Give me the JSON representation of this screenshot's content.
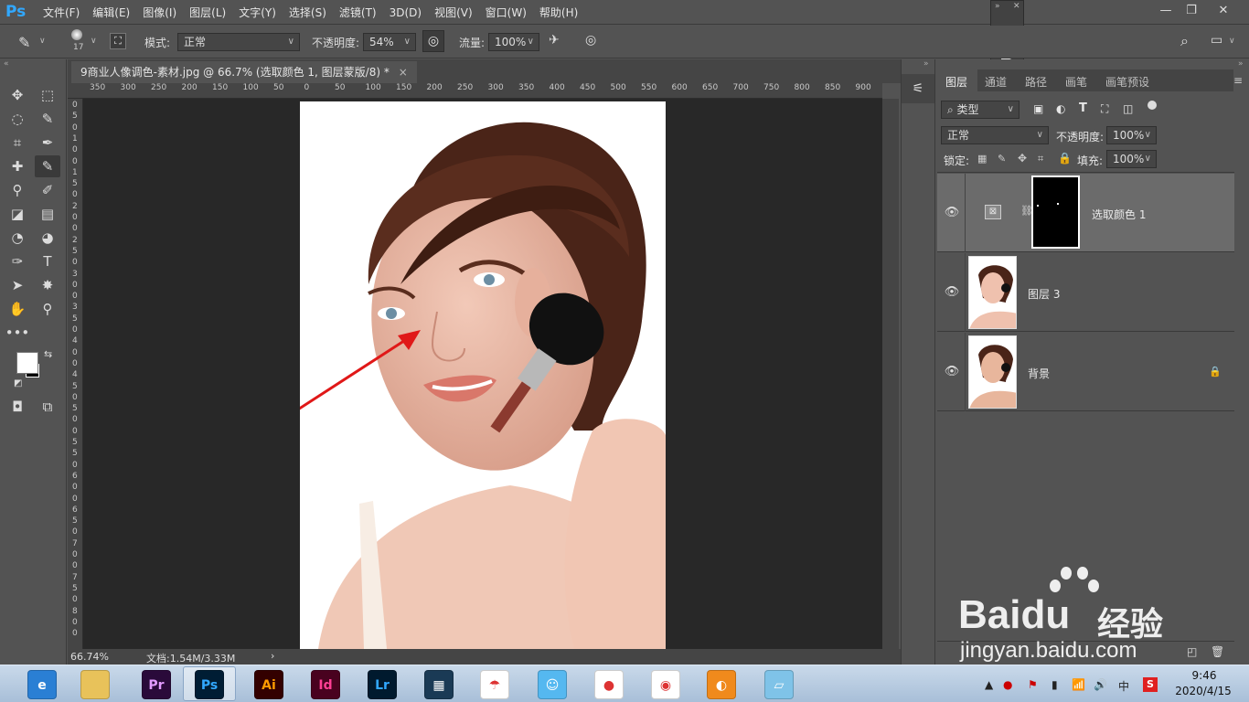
{
  "app": {
    "logo": "Ps"
  },
  "menu": [
    "文件(F)",
    "编辑(E)",
    "图像(I)",
    "图层(L)",
    "文字(Y)",
    "选择(S)",
    "滤镜(T)",
    "3D(D)",
    "视图(V)",
    "窗口(W)",
    "帮助(H)"
  ],
  "options": {
    "brush_size": "17",
    "mode_label": "模式:",
    "mode_value": "正常",
    "opacity_label": "不透明度:",
    "opacity_value": "54%",
    "flow_label": "流量:",
    "flow_value": "100%"
  },
  "document": {
    "tab_title": "9商业人像调色-素材.jpg @ 66.7% (选取颜色 1, 图层蒙版/8) *",
    "close": "×",
    "ruler_top": [
      "350",
      "300",
      "250",
      "200",
      "150",
      "100",
      "50",
      "0",
      "50",
      "100",
      "150",
      "200",
      "250",
      "300",
      "350",
      "400",
      "450",
      "500",
      "550",
      "600",
      "650",
      "700",
      "750",
      "800",
      "850",
      "900"
    ],
    "ruler_left": [
      "0",
      "5",
      "0",
      "1",
      "0",
      "0",
      "1",
      "5",
      "0",
      "2",
      "0",
      "0",
      "2",
      "5",
      "0",
      "3",
      "0",
      "0",
      "3",
      "5",
      "0",
      "4",
      "0",
      "0",
      "4",
      "5",
      "0",
      "5",
      "0",
      "0",
      "5",
      "5",
      "0",
      "6",
      "0",
      "0",
      "6",
      "5",
      "0",
      "7",
      "0",
      "0",
      "7",
      "5",
      "0",
      "8",
      "0",
      "0"
    ]
  },
  "status": {
    "zoom": "66.74%",
    "doc_info": "文档:1.54M/3.33M",
    "arrow": "›"
  },
  "panel": {
    "tabs": [
      "图层",
      "通道",
      "路径",
      "画笔",
      "画笔预设"
    ],
    "filter_label": "类型",
    "blend_mode": "正常",
    "opacity_label": "不透明度:",
    "opacity_value": "100%",
    "lock_label": "锁定:",
    "fill_label": "填充:",
    "fill_value": "100%"
  },
  "layers": [
    {
      "name": "选取颜色 1",
      "type": "adjustment",
      "selected": true
    },
    {
      "name": "图层 3",
      "type": "image",
      "selected": false
    },
    {
      "name": "背景",
      "type": "image",
      "selected": false,
      "locked": true
    }
  ],
  "watermark": {
    "brand": "Bai",
    "brand2": "du",
    "product": "经验",
    "url": "jingyan.baidu.com"
  },
  "taskbar": {
    "apps": [
      {
        "name": "ie",
        "label": "e",
        "color": "#2a7fd4"
      },
      {
        "name": "explorer",
        "label": "",
        "color": "#e8c25a"
      },
      {
        "name": "premiere",
        "label": "Pr",
        "color": "#2a0a3a"
      },
      {
        "name": "photoshop",
        "label": "Ps",
        "color": "#001d34"
      },
      {
        "name": "illustrator",
        "label": "Ai",
        "color": "#330000"
      },
      {
        "name": "indesign",
        "label": "Id",
        "color": "#49021f"
      },
      {
        "name": "lightroom",
        "label": "Lr",
        "color": "#001a2e"
      },
      {
        "name": "video",
        "label": "▦",
        "color": "#1a3a55"
      },
      {
        "name": "umbrella",
        "label": "☂",
        "color": "#ffffff"
      },
      {
        "name": "chat",
        "label": "☺",
        "color": "#55b8f0"
      },
      {
        "name": "qq",
        "label": "●",
        "color": "#ffffff"
      },
      {
        "name": "chrome",
        "label": "◉",
        "color": "#ffffff"
      },
      {
        "name": "browser",
        "label": "◐",
        "color": "#f08a1c"
      },
      {
        "name": "notepad",
        "label": "▱",
        "color": "#7fc3e8"
      }
    ],
    "tray_lang": "中",
    "time": "9:46",
    "date": "2020/4/15"
  },
  "colors": {
    "accent_ps": "#31a8ff",
    "panel_bg": "#535353",
    "dark_bg": "#282828",
    "selected_layer": "#6b6b6b"
  }
}
